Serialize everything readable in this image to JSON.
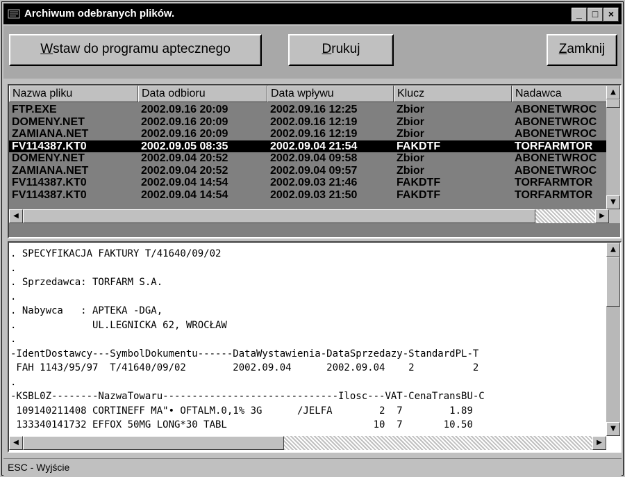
{
  "window": {
    "title": "Archiwum odebranych plików.",
    "controls": {
      "minimize": "_",
      "maximize": "□",
      "close": "×"
    }
  },
  "toolbar": {
    "insert_button": {
      "mnemonic": "W",
      "rest": "staw., do programu aptecznego"
    },
    "print_button": {
      "mnemonic": "D",
      "rest": "rukuj"
    },
    "close_button": {
      "mnemonic": "Z",
      "rest": "amknij"
    }
  },
  "file_list": {
    "columns": [
      "Nazwa pliku",
      "Data odbioru",
      "Data wpływu",
      "Klucz",
      "Nadawca"
    ],
    "selected_row": 3,
    "rows": [
      [
        "FTP.EXE",
        "2002.09.16 20:09",
        "2002.09.16 12:25",
        "Zbior",
        "ABONETWROC"
      ],
      [
        "DOMENY.NET",
        "2002.09.16 20:09",
        "2002.09.16 12:19",
        "Zbior",
        "ABONETWROC"
      ],
      [
        "ZAMIANA.NET",
        "2002.09.16 20:09",
        "2002.09.16 12:19",
        "Zbior",
        "ABONETWROC"
      ],
      [
        "FV114387.KT0",
        "2002.09.05 08:35",
        "2002.09.04 21:54",
        "FAKDTF",
        "TORFARMTOR"
      ],
      [
        "DOMENY.NET",
        "2002.09.04 20:52",
        "2002.09.04 09:58",
        "Zbior",
        "ABONETWROC"
      ],
      [
        "ZAMIANA.NET",
        "2002.09.04 20:52",
        "2002.09.04 09:57",
        "Zbior",
        "ABONETWROC"
      ],
      [
        "FV114387.KT0",
        "2002.09.04 14:54",
        "2002.09.03 21:46",
        "FAKDTF",
        "TORFARMTOR"
      ],
      [
        "FV114387.KT0",
        "2002.09.04 14:54",
        "2002.09.03 21:50",
        "FAKDTF",
        "TORFARMTOR"
      ]
    ]
  },
  "document": {
    "lines": [
      ". SPECYFIKACJA FAKTURY T/41640/09/02",
      ".",
      ". Sprzedawca: TORFARM S.A.",
      ".",
      ". Nabywca   : APTEKA -DGA,",
      ".             UL.LEGNICKA 62, WROCŁAW",
      ".",
      "-IdentDostawcy---SymbolDokumentu------DataWystawienia-DataSprzedazy-StandardPL-T",
      " FAH 1143/95/97  T/41640/09/02        2002.09.04      2002.09.04    2          2",
      ".",
      "-KSBL0Z--------NazwaTowaru------------------------------Ilosc---VAT-CenaTransBU-C",
      " 109140211408 CORTINEFF MA\"• OFTALM.0,1% 3G      /JELFA        2  7        1.89",
      " 133340141732 EFFOX 50MG LONG*30 TABL                         10  7       10.50"
    ]
  },
  "status_bar": {
    "text": "ESC - Wyjście"
  }
}
